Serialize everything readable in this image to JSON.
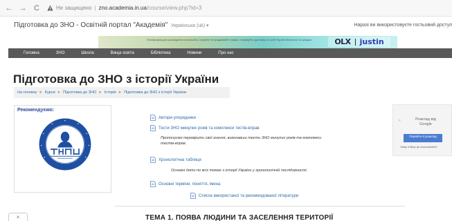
{
  "browser": {
    "back": "←",
    "forward": "→",
    "reload": "C",
    "insecure_label": "Не защищено",
    "url_host": "zno.academia.in.ua",
    "url_path": "/course/view.php?id=3",
    "warning_color": "#666666"
  },
  "header": {
    "site_title": "Підготовка до ЗНО - Освітній портал \"Академія\"",
    "language": "Українська (uk) ▾",
    "user_note": "Наразі ви використовуєте гостьовий доступ"
  },
  "ad": {
    "text": "Платформа для розміщення оголошень. Купуйте та продавайте товари, отримуйте доставку по всій Україні безпечно та швидко.",
    "logo_olx": "OLX",
    "logo_justin": "justin"
  },
  "nav": {
    "items": [
      "Головна",
      "ЗНО",
      "Школа",
      "Вища освіта",
      "Бібліотека",
      "Новини",
      "Про нас"
    ]
  },
  "page": {
    "title": "Підготовка до ЗНО з історії України",
    "breadcrumb": [
      "На головну",
      "Курси",
      "Підготовка до ЗНО",
      "Історія",
      "Підготовка до ЗНО з історії України"
    ],
    "breadcrumb_sep": "►"
  },
  "recommend": {
    "title": "Рекомендуємо:",
    "logo_text": "ТНПУ",
    "logo_year": "1940",
    "logo_ring_text": "ТЕРНОПІЛЬСЬКИЙ НАЦІОНАЛЬНИЙ ПЕДАГОГІЧНИЙ УНІВЕРСИТЕТ"
  },
  "resources": {
    "item1": "Автори-упорядники",
    "item2": "Тести ЗНО минулих років та комплекси тестів-вправ",
    "item2_desc_line1": "Пропонуємо перевірити свої знання, виконавши тести ЗНО минулих років та комплекси",
    "item2_desc_line2": "тестів-вправ.",
    "item3": "Хронологічна таблиця",
    "item3_desc": "Основні дати по всіх темах з історії України у хронологічній послідовності.",
    "item4": "Основні терміни, поняття, імена",
    "item5": "Список використаної та рекомендованої літератури"
  },
  "side": {
    "x": "×",
    "text": "Розклад від Google",
    "button": "Перейти в розклад",
    "link": "Чому я бачу це оголошення?"
  },
  "bottom": {
    "close": "×",
    "topic": "ТЕМА 1. ПОЯВА ЛЮДИНИ ТА ЗАСЕЛЕННЯ ТЕРИТОРІЇ"
  }
}
